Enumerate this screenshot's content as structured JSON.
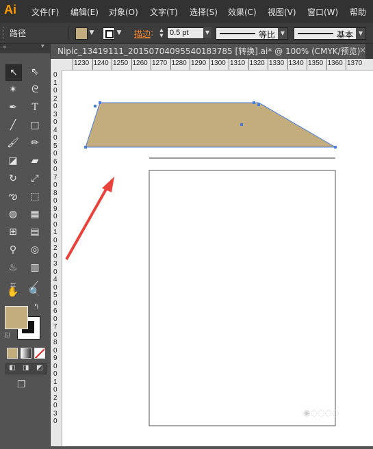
{
  "app": {
    "logo": "Ai"
  },
  "menu": [
    "文件(F)",
    "编辑(E)",
    "对象(O)",
    "文字(T)",
    "选择(S)",
    "效果(C)",
    "视图(V)",
    "窗口(W)",
    "帮助"
  ],
  "control_bar": {
    "selection_label": "路径",
    "stroke_label": "描边",
    "stroke_weight": "0.5 pt",
    "profile_label": "等比",
    "brush_label": "基本",
    "fill_color": "#c4ad7c"
  },
  "document": {
    "tab_title": "Nipic_13419111_20150704095540183785 [转换].ai* @ 100% (CMYK/预览)"
  },
  "ruler": {
    "h_ticks": [
      "1230",
      "1240",
      "1250",
      "1260",
      "1270",
      "1280",
      "1290",
      "1300",
      "1310",
      "1320",
      "1330",
      "1340",
      "1350",
      "1360",
      "1370"
    ],
    "v_ticks": [
      "0",
      "1",
      "0",
      "2",
      "0",
      "3",
      "0",
      "4",
      "0",
      "5",
      "0",
      "6",
      "0",
      "7",
      "0",
      "8",
      "0",
      "9",
      "0",
      "0",
      "1",
      "0",
      "2",
      "0",
      "3",
      "0",
      "4",
      "0",
      "5",
      "0",
      "6",
      "0",
      "7",
      "0",
      "8",
      "0",
      "9",
      "0",
      "0",
      "1",
      "0",
      "2",
      "0",
      "3",
      "0"
    ]
  },
  "swatches": {
    "fill": "#c4ad7c",
    "stroke": "#111111",
    "shape_fill": "#c4ad7c",
    "selection_color": "#4a7fe0",
    "arrow_color": "#e8423a"
  },
  "tools": [
    "selection-tool-icon",
    "direct-selection-tool-icon",
    "magic-wand-tool-icon",
    "lasso-tool-icon",
    "pen-tool-icon",
    "type-tool-icon",
    "line-tool-icon",
    "rectangle-tool-icon",
    "paintbrush-tool-icon",
    "pencil-tool-icon",
    "blob-brush-tool-icon",
    "eraser-tool-icon",
    "rotate-tool-icon",
    "scale-tool-icon",
    "warp-tool-icon",
    "free-transform-tool-icon",
    "shape-builder-tool-icon",
    "perspective-grid-tool-icon",
    "mesh-tool-icon",
    "gradient-tool-icon",
    "eyedropper-tool-icon",
    "blend-tool-icon",
    "symbol-sprayer-tool-icon",
    "column-graph-tool-icon",
    "artboard-tool-icon",
    "slice-tool-icon",
    "hand-tool-icon",
    "zoom-tool-icon"
  ]
}
